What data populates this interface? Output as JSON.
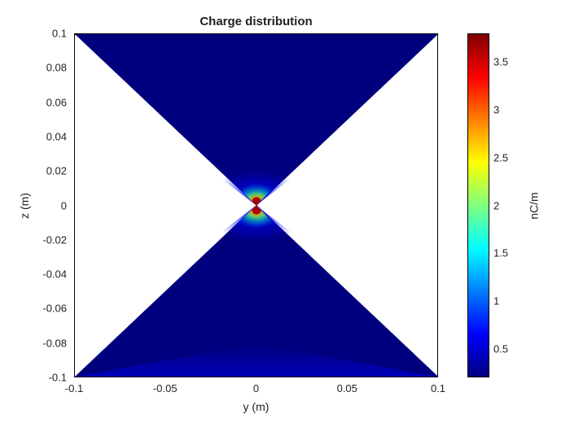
{
  "chart_data": {
    "type": "heatmap",
    "title": "Charge distribution",
    "xlabel": "y (m)",
    "ylabel": "z (m)",
    "xlim": [
      -0.1,
      0.1
    ],
    "ylim": [
      -0.1,
      0.1
    ],
    "xticks": [
      -0.1,
      -0.05,
      0,
      0.05,
      0.1
    ],
    "yticks": [
      -0.1,
      -0.08,
      -0.06,
      -0.04,
      -0.02,
      0,
      0.02,
      0.04,
      0.06,
      0.08,
      0.1
    ],
    "colorbar": {
      "label": "nC/m",
      "range": [
        0.2,
        3.8
      ],
      "ticks": [
        0.5,
        1,
        1.5,
        2,
        2.5,
        3,
        3.5
      ],
      "colormap": "jet"
    },
    "domain_shape": "bowtie (two 90° apex triangles touching at origin, spanning full z-range)",
    "field_description": "Charge density ~0.2–0.3 nC/m over most of triangular region (dark blue); slight increase toward bottom edge; strong peak at origin reaching ~3.6 nC/m with concentric jet-colored bands (cyan→green→yellow→orange→dark red) within |y|,|z| ≲ 0.01 m; peak appears as two small lobes just above and below z=0."
  },
  "title": "Charge distribution",
  "xlabel": "y (m)",
  "ylabel": "z (m)",
  "cbar_label": "nC/m",
  "xticks": [
    "-0.1",
    "-0.05",
    "0",
    "0.05",
    "0.1"
  ],
  "yticks": [
    "-0.1",
    "-0.08",
    "-0.06",
    "-0.04",
    "-0.02",
    "0",
    "0.02",
    "0.04",
    "0.06",
    "0.08",
    "0.1"
  ],
  "cticks": [
    "0.5",
    "1",
    "1.5",
    "2",
    "2.5",
    "3",
    "3.5"
  ]
}
